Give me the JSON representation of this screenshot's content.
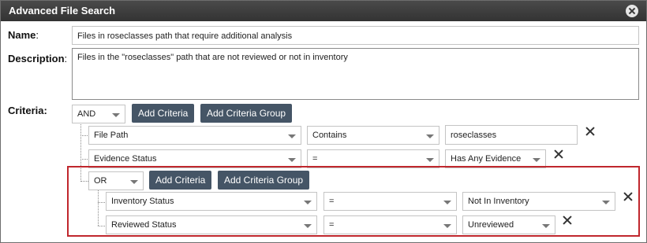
{
  "dialog": {
    "title": "Advanced File Search"
  },
  "form": {
    "name_label": "Name",
    "name_value": "Files in roseclasses path that require additional analysis",
    "description_label": "Description",
    "description_value": "Files in the \"roseclasses\" path that are not reviewed or not in inventory",
    "criteria_label": "Criteria:"
  },
  "root_group": {
    "operator": "AND",
    "add_criteria_label": "Add Criteria",
    "add_group_label": "Add Criteria Group",
    "rows": [
      {
        "field": "File Path",
        "op": "Contains",
        "value": "roseclasses"
      },
      {
        "field": "Evidence Status",
        "op": "=",
        "value": "Has Any Evidence"
      }
    ]
  },
  "sub_group": {
    "operator": "OR",
    "add_criteria_label": "Add Criteria",
    "add_group_label": "Add Criteria Group",
    "rows": [
      {
        "field": "Inventory Status",
        "op": "=",
        "value": "Not In Inventory"
      },
      {
        "field": "Reviewed Status",
        "op": "=",
        "value": "Unreviewed"
      }
    ]
  },
  "colors": {
    "title_bar": "#333333",
    "button": "#455566",
    "highlight": "#c0272d"
  },
  "icons": {
    "close": "close-circle-icon",
    "delete": "x-icon",
    "dropdown": "chevron-down-icon"
  }
}
